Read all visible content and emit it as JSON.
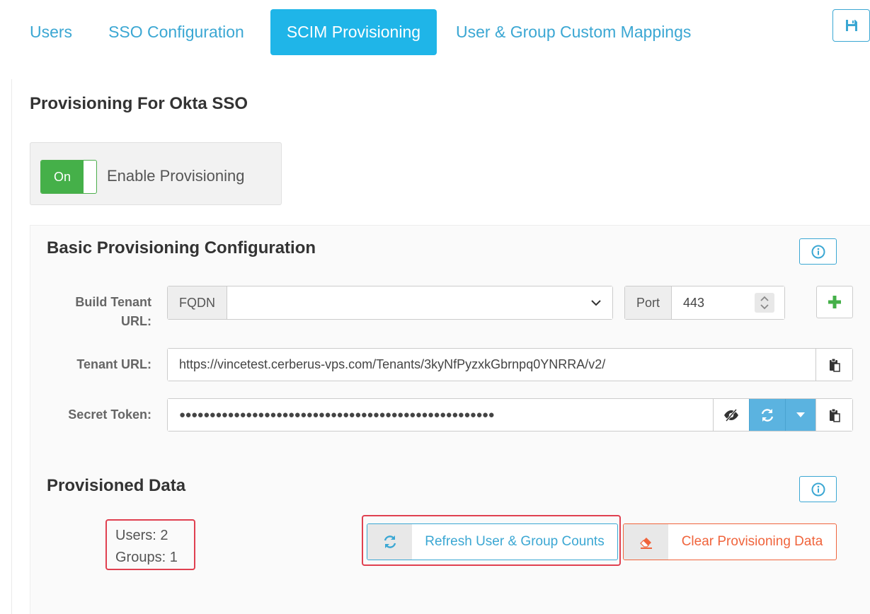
{
  "tabs": [
    {
      "label": "Users"
    },
    {
      "label": "SSO Configuration"
    },
    {
      "label": "SCIM Provisioning"
    },
    {
      "label": "User & Group Custom Mappings"
    }
  ],
  "page_title": "Provisioning For Okta SSO",
  "toggle": {
    "state_label": "On",
    "label": "Enable Provisioning"
  },
  "basic": {
    "title": "Basic Provisioning Configuration",
    "build_tenant_label": "Build Tenant URL:",
    "fqdn_addon": "FQDN",
    "fqdn_value": "",
    "port_addon": "Port",
    "port_value": "443",
    "tenant_url_label": "Tenant URL:",
    "tenant_url_value": "https://vincetest.cerberus-vps.com/Tenants/3kyNfPyzxkGbrnpq0YNRRA/v2/",
    "secret_label": "Secret Token:",
    "secret_value": "●●●●●●●●●●●●●●●●●●●●●●●●●●●●●●●●●●●●●●●●●●●●●●●●●●●●"
  },
  "provisioned": {
    "title": "Provisioned Data",
    "users": "Users: 2",
    "groups": "Groups: 1",
    "refresh_label": "Refresh User & Group Counts",
    "clear_label": "Clear Provisioning Data"
  },
  "colors": {
    "accent": "#1fb5e8",
    "link": "#3ba7d3",
    "success": "#45b049",
    "danger": "#f0643c",
    "highlight": "#e04050"
  },
  "icons": [
    "save-icon",
    "info-icon",
    "chevron-down-icon",
    "spinner-icon",
    "plus-icon",
    "paste-icon",
    "eye-slash-icon",
    "refresh-icon",
    "caret-down-icon",
    "eraser-icon"
  ]
}
